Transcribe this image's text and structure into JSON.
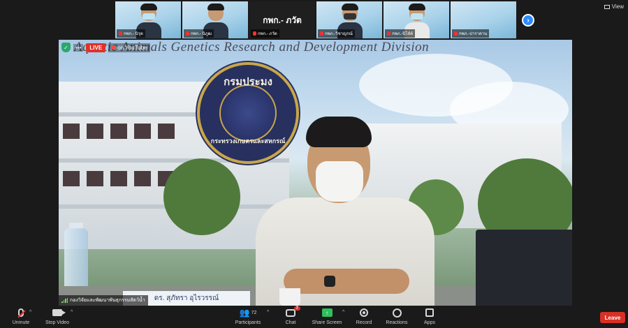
{
  "thumbnails": [
    {
      "label": "กพก.- นิรุต",
      "mask": "light"
    },
    {
      "label": "กพก.- นิภูฒ",
      "mask": "none"
    },
    {
      "label": "กพก.- ภวัต",
      "center_name": "กพก.- ภวัต",
      "type": "name-only"
    },
    {
      "label": "กพภ.-วิชาญรณ์",
      "mask": "dark"
    },
    {
      "label": "กพภ.-นิโส์ต์",
      "mask": "light"
    },
    {
      "label": "กพภ.-ปาราดาน",
      "type": "empty"
    }
  ],
  "next_button_label": "›",
  "view_button_label": "View",
  "main_video": {
    "banner_text": "Aquatic Animals Genetics Research and Development Division",
    "seal_top_text": "กรมประมง",
    "seal_bottom_text": "กระทรวงเกษตรและสหกรณ์",
    "nameplate_text": "ดร. สุภัทรา อุไรวรรณ์",
    "live_label": "LIVE",
    "youtube_label": "on YouTube",
    "caption_text": "กองวิจัยและพัฒนาพันธุกรรมสัตว์น้ำ"
  },
  "toolbar": {
    "unmute_label": "Unmute",
    "stop_video_label": "Stop Video",
    "participants_label": "Participants",
    "participants_count": "72",
    "chat_label": "Chat",
    "chat_badge": "7",
    "share_screen_label": "Share Screen",
    "record_label": "Record",
    "reactions_label": "Reactions",
    "apps_label": "Apps",
    "leave_label": "Leave"
  },
  "colors": {
    "accent_blue": "#2d8cff",
    "share_green": "#2fbf5b",
    "leave_red": "#d93025",
    "live_red": "#e0322a"
  }
}
